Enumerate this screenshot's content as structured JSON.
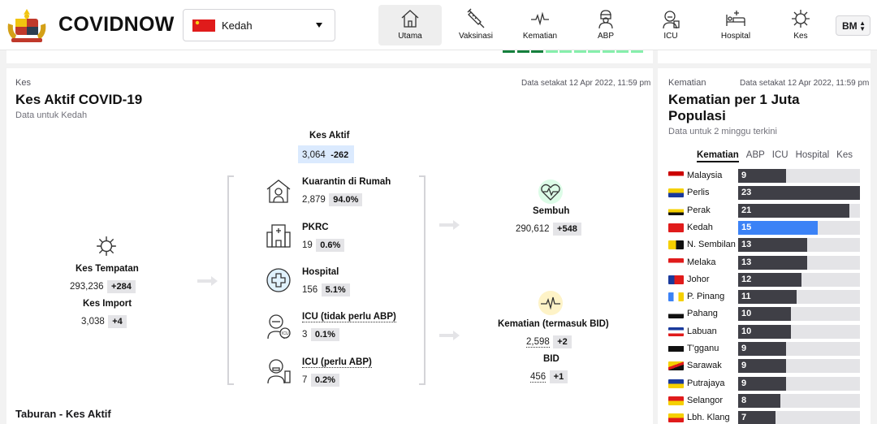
{
  "header": {
    "brand": "COVIDNOW",
    "state_selected": "Kedah",
    "language": "BM",
    "nav": [
      {
        "label": "Utama",
        "icon": "home-icon",
        "active": true
      },
      {
        "label": "Vaksinasi",
        "icon": "syringe-icon",
        "active": false
      },
      {
        "label": "Kematian",
        "icon": "heartbeat-icon",
        "active": false
      },
      {
        "label": "ABP",
        "icon": "doctor-icon",
        "active": false
      },
      {
        "label": "ICU",
        "icon": "icu-patient-icon",
        "active": false
      },
      {
        "label": "Hospital",
        "icon": "hospital-bed-icon",
        "active": false
      },
      {
        "label": "Kes",
        "icon": "virus-icon",
        "active": false
      }
    ]
  },
  "main": {
    "section": "Kes",
    "title": "Kes Aktif COVID-19",
    "subtitle": "Data untuk Kedah",
    "updated": "Data setakat 12 Apr 2022, 11:59 pm",
    "kes_aktif": {
      "label": "Kes Aktif",
      "value": "3,064",
      "delta": "-262"
    },
    "kes_tempatan": {
      "label": "Kes Tempatan",
      "value": "293,236",
      "delta": "+284"
    },
    "kes_import": {
      "label": "Kes Import",
      "value": "3,038",
      "delta": "+4"
    },
    "categories": [
      {
        "label": "Kuarantin di Rumah",
        "value": "2,879",
        "pct": "94.0%",
        "icon": "home-quarantine-icon"
      },
      {
        "label": "PKRC",
        "value": "19",
        "pct": "0.6%",
        "icon": "pkrc-building-icon"
      },
      {
        "label": "Hospital",
        "value": "156",
        "pct": "5.1%",
        "icon": "hospital-cross-icon"
      },
      {
        "label": "ICU (tidak perlu ABP)",
        "value": "3",
        "pct": "0.1%",
        "icon": "icu-icon"
      },
      {
        "label": "ICU (perlu ABP)",
        "value": "7",
        "pct": "0.2%",
        "icon": "ventilator-icon"
      }
    ],
    "sembuh": {
      "label": "Sembuh",
      "value": "290,612",
      "delta": "+548"
    },
    "kematian": {
      "label": "Kematian (termasuk BID)",
      "value": "2,598",
      "delta": "+2"
    },
    "bid": {
      "label": "BID",
      "value": "456",
      "delta": "+1"
    },
    "next_section": "Taburan - Kes Aktif",
    "colors": {
      "green": "#15803d",
      "light_green": "#86efac",
      "blue_highlight": "#dbeafe"
    }
  },
  "side": {
    "section": "Kematian",
    "updated": "Data setakat 12 Apr 2022, 11:59 pm",
    "title": "Kematian per 1 Juta Populasi",
    "subtitle": "Data untuk 2 minggu terkini",
    "tabs": [
      "Kematian",
      "ABP",
      "ICU",
      "Hospital",
      "Kes"
    ],
    "active_tab": "Kematian",
    "highlight_color": "#3b82f6",
    "bar_color": "#3f3f46",
    "max_value": 23,
    "states": [
      {
        "name": "Malaysia",
        "value": 9
      },
      {
        "name": "Perlis",
        "value": 23
      },
      {
        "name": "Perak",
        "value": 21
      },
      {
        "name": "Kedah",
        "value": 15,
        "highlight": true
      },
      {
        "name": "N. Sembilan",
        "value": 13
      },
      {
        "name": "Melaka",
        "value": 13
      },
      {
        "name": "Johor",
        "value": 12
      },
      {
        "name": "P. Pinang",
        "value": 11
      },
      {
        "name": "Pahang",
        "value": 10
      },
      {
        "name": "Labuan",
        "value": 10
      },
      {
        "name": "T'gganu",
        "value": 9
      },
      {
        "name": "Sarawak",
        "value": 9
      },
      {
        "name": "Putrajaya",
        "value": 9
      },
      {
        "name": "Selangor",
        "value": 8
      },
      {
        "name": "Lbh. Klang",
        "value": 7
      }
    ]
  }
}
